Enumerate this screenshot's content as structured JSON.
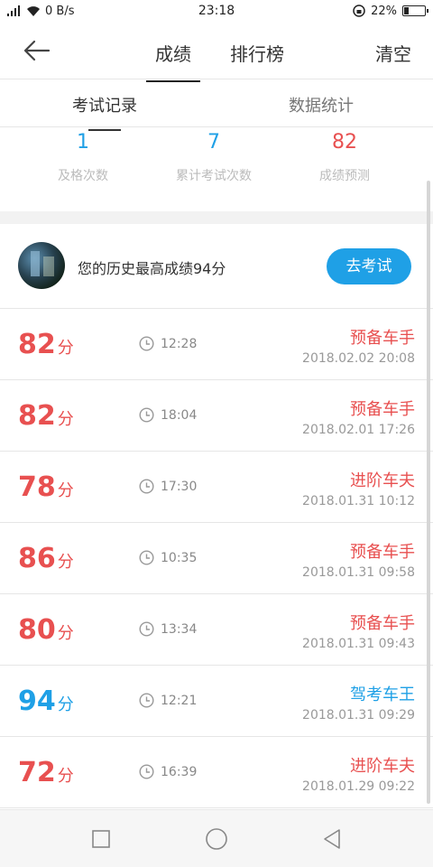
{
  "status_bar": {
    "network": "0 B/s",
    "time": "23:18",
    "battery": "22%",
    "battery_level": 0.22
  },
  "header": {
    "tabs": [
      {
        "label": "成绩",
        "active": true
      },
      {
        "label": "排行榜",
        "active": false
      }
    ],
    "clear_label": "清空",
    "back_icon": "arrow-left-icon"
  },
  "sub_tabs": [
    {
      "label": "考试记录",
      "active": true
    },
    {
      "label": "数据统计",
      "active": false
    }
  ],
  "stats": [
    {
      "value": "1",
      "label": "及格次数",
      "color": "#1fa0e6"
    },
    {
      "value": "7",
      "label": "累计考试次数",
      "color": "#1fa0e6"
    },
    {
      "value": "82",
      "label": "成绩预测",
      "color": "#e85050"
    }
  ],
  "best": {
    "text": "您的历史最高成绩94分",
    "button_label": "去考试"
  },
  "records": [
    {
      "score": "82",
      "unit": "分",
      "time": "12:28",
      "rank": "预备车手",
      "date": "2018.02.02  20:08",
      "color": "red"
    },
    {
      "score": "82",
      "unit": "分",
      "time": "18:04",
      "rank": "预备车手",
      "date": "2018.02.01  17:26",
      "color": "red"
    },
    {
      "score": "78",
      "unit": "分",
      "time": "17:30",
      "rank": "进阶车夫",
      "date": "2018.01.31  10:12",
      "color": "red"
    },
    {
      "score": "86",
      "unit": "分",
      "time": "10:35",
      "rank": "预备车手",
      "date": "2018.01.31  09:58",
      "color": "red"
    },
    {
      "score": "80",
      "unit": "分",
      "time": "13:34",
      "rank": "预备车手",
      "date": "2018.01.31  09:43",
      "color": "red"
    },
    {
      "score": "94",
      "unit": "分",
      "time": "12:21",
      "rank": "驾考车王",
      "date": "2018.01.31  09:29",
      "color": "blue"
    },
    {
      "score": "72",
      "unit": "分",
      "time": "16:39",
      "rank": "进阶车夫",
      "date": "2018.01.29  09:22",
      "color": "red"
    }
  ],
  "colors": {
    "accent_blue": "#1fa0e6",
    "score_red": "#e85050"
  }
}
